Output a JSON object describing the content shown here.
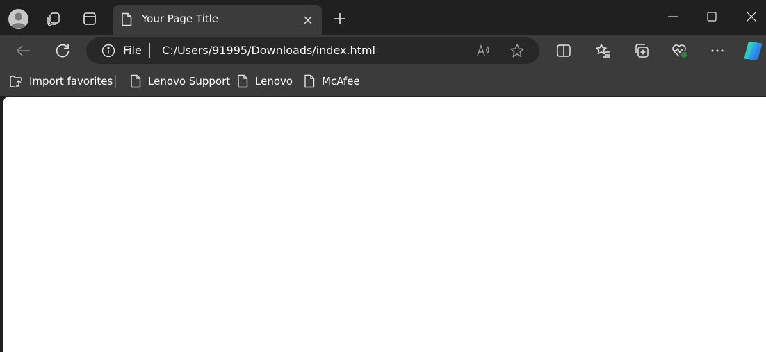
{
  "window": {
    "tab_title": "Your Page Title"
  },
  "address_bar": {
    "scheme_label": "File",
    "url": "C:/Users/91995/Downloads/index.html"
  },
  "favorites_bar": {
    "items": [
      {
        "label": "Import favorites",
        "icon": "import-favorites-icon"
      },
      {
        "label": "Lenovo Support",
        "icon": "page-icon"
      },
      {
        "label": "Lenovo",
        "icon": "page-icon"
      },
      {
        "label": "McAfee",
        "icon": "page-icon"
      }
    ]
  },
  "colors": {
    "chrome_dark": "#202020",
    "toolbar": "#3b3b3b",
    "omnibox": "#282828",
    "page_bg": "#ffffff",
    "health_badge": "#1f8f3a"
  }
}
